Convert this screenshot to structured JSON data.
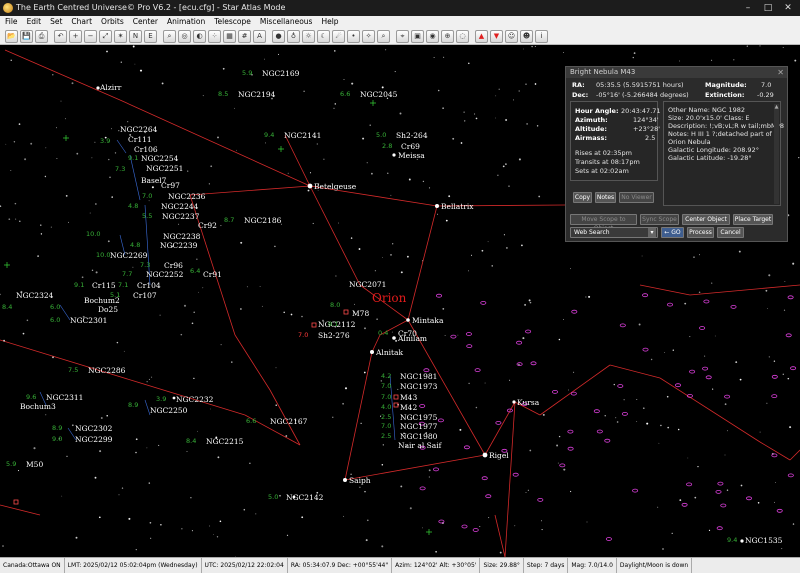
{
  "window": {
    "title": "The Earth Centred Universe© Pro V6.2 - [ecu.cfg] - Star Atlas Mode",
    "controls": [
      "–",
      "□",
      "✕"
    ]
  },
  "menu": [
    "File",
    "Edit",
    "Set",
    "Chart",
    "Orbits",
    "Center",
    "Animation",
    "Telescope",
    "Miscellaneous",
    "Help"
  ],
  "toolbar": {
    "groups": [
      [
        "open-icon",
        "save-icon",
        "print-icon"
      ],
      [
        "undo-icon",
        "zoom-in-icon",
        "zoom-out-icon",
        "zoom-fit-icon",
        "star-icon",
        "ns-flip-icon",
        "ew-flip-icon"
      ],
      [
        "search-icon",
        "ring-icon",
        "galaxy-icon",
        "cluster-icon",
        "map-icon",
        "grid-icon",
        "label-icon"
      ],
      [
        "earth-icon",
        "planet-icon",
        "sun-icon",
        "moon-icon",
        "comet-icon",
        "asteroid-icon",
        "meteor-icon",
        "magnify-icon"
      ],
      [
        "telescope-icon",
        "camera-icon",
        "target-icon",
        "reticle-icon",
        "eyepiece-icon"
      ],
      [
        "arrow-up-icon",
        "arrow-down-icon",
        "walk-icon",
        "walk-alt-icon",
        "info-icon"
      ]
    ]
  },
  "sky": {
    "constellation": "Orion",
    "stars": [
      {
        "name": "Alzirr",
        "mag": ""
      },
      {
        "name": "Betelgeuse",
        "mag": ""
      },
      {
        "name": "Meissa",
        "mag": ""
      },
      {
        "name": "Bellatrix",
        "mag": ""
      },
      {
        "name": "Mintaka",
        "mag": ""
      },
      {
        "name": "Alnilam",
        "mag": ""
      },
      {
        "name": "Alnitak",
        "mag": ""
      },
      {
        "name": "Nair al Saif",
        "mag": ""
      },
      {
        "name": "Rigel",
        "mag": ""
      },
      {
        "name": "Saiph",
        "mag": ""
      },
      {
        "name": "Kursa",
        "mag": ""
      }
    ],
    "labels": [
      {
        "text": "NGC2169",
        "mag": "5.9"
      },
      {
        "text": "NGC2194",
        "mag": "8.5"
      },
      {
        "text": "NGC2045",
        "mag": "6.6"
      },
      {
        "text": "NGC2141",
        "mag": "9.4"
      },
      {
        "text": "Sh2-264",
        "mag": "5.0"
      },
      {
        "text": "Cr69",
        "mag": "2.8"
      },
      {
        "text": "NGC2264",
        "mag": "3.9"
      },
      {
        "text": "Cr111",
        "mag": ""
      },
      {
        "text": "Cr106",
        "mag": ""
      },
      {
        "text": "NGC2254",
        "mag": "9.1"
      },
      {
        "text": "NGC2251",
        "mag": "7.3"
      },
      {
        "text": "Basel7",
        "mag": ""
      },
      {
        "text": "Cr97",
        "mag": ""
      },
      {
        "text": "NGC2236",
        "mag": "7.0"
      },
      {
        "text": "NGC2244",
        "mag": "4.8"
      },
      {
        "text": "NGC2237",
        "mag": "5.5"
      },
      {
        "text": "Cr92",
        "mag": ""
      },
      {
        "text": "NGC2186",
        "mag": "8.7"
      },
      {
        "text": "NGC2238",
        "mag": "10.0"
      },
      {
        "text": "NGC2239",
        "mag": "4.8"
      },
      {
        "text": "NGC2269",
        "mag": "10.0"
      },
      {
        "text": "Cr96",
        "mag": "7.3"
      },
      {
        "text": "NGC2252",
        "mag": "7.7"
      },
      {
        "text": "Cr91",
        "mag": "6.4"
      },
      {
        "text": "Cr115",
        "mag": "9.1"
      },
      {
        "text": "Cr104",
        "mag": "7.1"
      },
      {
        "text": "Cr107",
        "mag": "5.1"
      },
      {
        "text": "NGC2324",
        "mag": "8.4"
      },
      {
        "text": "Bochum2",
        "mag": ""
      },
      {
        "text": "Do25",
        "mag": "6.0"
      },
      {
        "text": "NGC2301",
        "mag": "6.0"
      },
      {
        "text": "NGC2071",
        "mag": ""
      },
      {
        "text": "M78",
        "mag": "8.0"
      },
      {
        "text": "NGC2112",
        "mag": "9.1"
      },
      {
        "text": "Sh2-276",
        "mag": "7.0"
      },
      {
        "text": "Cr70",
        "mag": "0.4"
      },
      {
        "text": "NGC2286",
        "mag": "7.5"
      },
      {
        "text": "NGC2311",
        "mag": "9.6"
      },
      {
        "text": "Bochum3",
        "mag": ""
      },
      {
        "text": "NGC2232",
        "mag": "3.9"
      },
      {
        "text": "NGC2250",
        "mag": "8.9"
      },
      {
        "text": "NGC1981",
        "mag": "4.2"
      },
      {
        "text": "NGC1973",
        "mag": "7.0"
      },
      {
        "text": "M43",
        "mag": "7.0"
      },
      {
        "text": "M42",
        "mag": "4.0"
      },
      {
        "text": "NGC1975",
        "mag": "2.5"
      },
      {
        "text": "NGC1977",
        "mag": "7.0"
      },
      {
        "text": "NGC1980",
        "mag": "2.5"
      },
      {
        "text": "NGC2302",
        "mag": "8.9"
      },
      {
        "text": "NGC2299",
        "mag": "9.0"
      },
      {
        "text": "NGC2167",
        "mag": "6.6"
      },
      {
        "text": "NGC2215",
        "mag": "8.4"
      },
      {
        "text": "M50",
        "mag": "5.9"
      },
      {
        "text": "NGC2142",
        "mag": "5.0"
      },
      {
        "text": "NGC1535",
        "mag": "9.4"
      }
    ]
  },
  "popup": {
    "title": "Bright Nebula M43",
    "close": "✕",
    "ra_label": "RA:",
    "ra": "05:35.5 (5.5915751 hours)",
    "dec_label": "Dec:",
    "dec": "-05°16' (-5.266484 degrees)",
    "mag_label": "Magnitude:",
    "mag": "7.0",
    "ext_label": "Extinction:",
    "ext": "-0.29",
    "hour_angle_label": "Hour Angle:",
    "hour_angle": "20:43:47.71",
    "azimuth_label": "Azimuth:",
    "azimuth": "124°34'",
    "altitude_label": "Altitude:",
    "altitude": "+23°28'",
    "airmass_label": "Airmass:",
    "airmass": "2.5",
    "rises": "Rises at 02:35pm",
    "transits": "Transits at 08:17pm",
    "sets": "Sets at 02:02am",
    "info": [
      "Other Name: NGC 1982",
      "Size: 20.0'x15.0'  Class: E",
      "Description: !;vB;vL;R w tail;mbM*8",
      "Notes: H III 1 ?;detached part of",
      "Orion Nebula",
      "Galactic Longitude: 208.92°",
      "Galactic Latitude: -19.28°"
    ],
    "buttons": {
      "copy": "Copy",
      "notes": "Notes",
      "no_viewer": "No Viewer",
      "move_scope": "Move Scope to Object",
      "sync_scope": "Sync Scope",
      "center": "Center Object",
      "place_target": "Place Target",
      "search_select": "Web Search",
      "go": "GO",
      "process": "Process",
      "cancel": "Cancel"
    }
  },
  "status": [
    "Canada:Ottawa ON",
    "LMT: 2025/02/12 05:02:04pm (Wednesday)",
    "UTC: 2025/02/12 22:02:04",
    "RA: 05:34:07.9 Dec: +00°55'44\"",
    "Azim: 124°02' Alt: +30°05'",
    "Size: 29.88°",
    "Step: 7 days",
    "Mag: 7.0/14.0",
    "Daylight/Moon is down"
  ],
  "colors": {
    "background": "#000000",
    "constellation_lines": "#d42a2a",
    "star_labels": "#ffffff",
    "magnitudes": "#37b037",
    "galaxies": "#e040e0",
    "constellation_name": "#e01b1b"
  }
}
